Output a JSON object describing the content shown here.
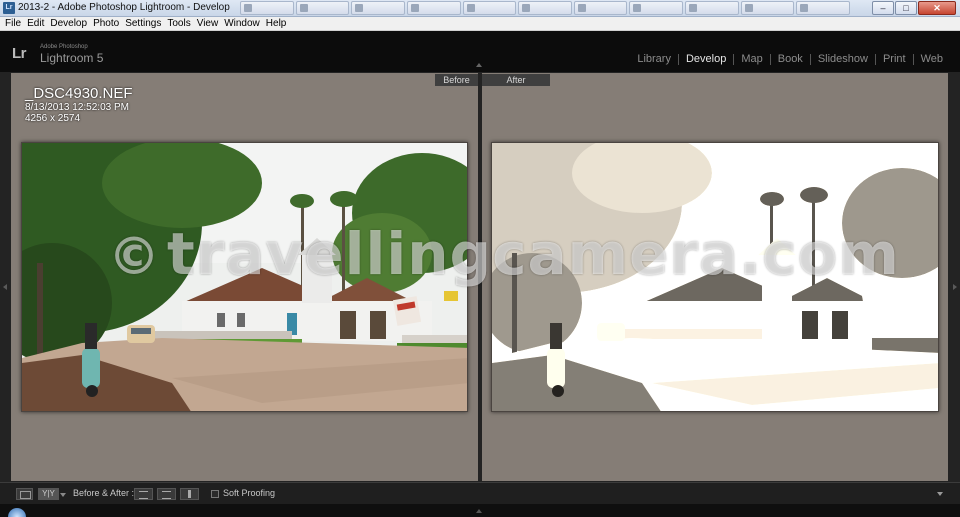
{
  "window": {
    "title": "2013-2 - Adobe Photoshop Lightroom - Develop",
    "taskbar_items": [
      "",
      "",
      "",
      "",
      "",
      "",
      "",
      "",
      "",
      "",
      ""
    ]
  },
  "menu": [
    "File",
    "Edit",
    "Develop",
    "Photo",
    "Settings",
    "Tools",
    "View",
    "Window",
    "Help"
  ],
  "brand": {
    "logo": "Lr",
    "vendor": "Adobe Photoshop",
    "product": "Lightroom 5"
  },
  "modules": {
    "items": [
      "Library",
      "Develop",
      "Map",
      "Book",
      "Slideshow",
      "Print",
      "Web"
    ],
    "active": "Develop"
  },
  "panes": {
    "before_label": "Before",
    "after_label": "After"
  },
  "photo_info": {
    "filename": "_DSC4930.NEF",
    "datetime": "8/13/2013 12:52:03 PM",
    "dimensions": "4256 x 2574"
  },
  "watermark": {
    "symbol": "©",
    "text": "travellingcamera.com"
  },
  "toolbar": {
    "view_mode": "Y|Y",
    "before_after_label": "Before & After :",
    "soft_proofing_label": "Soft Proofing",
    "soft_proofing_checked": false
  }
}
